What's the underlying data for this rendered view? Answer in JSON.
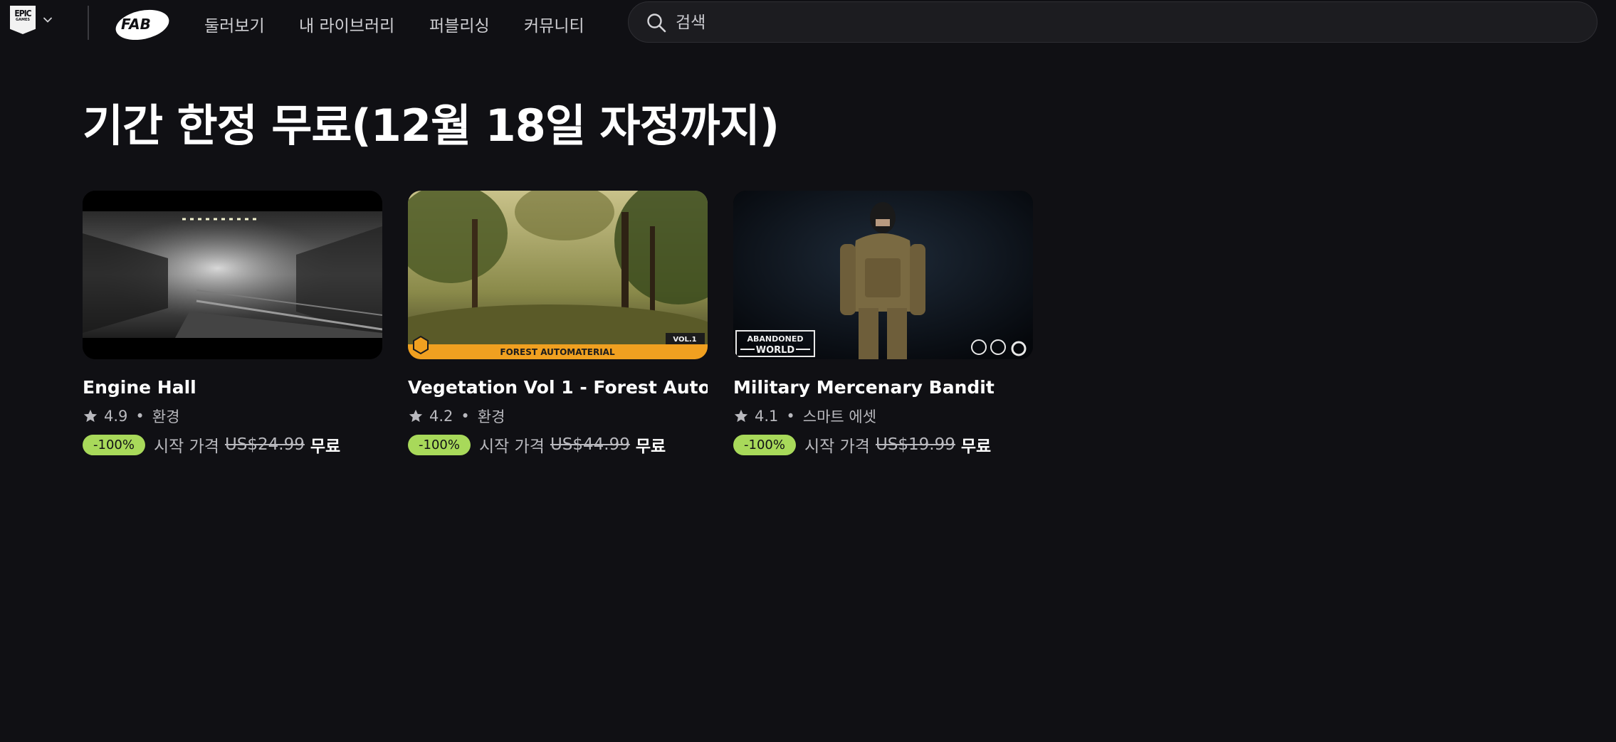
{
  "header": {
    "epic_logo_text": "EPIC",
    "epic_logo_subtext": "GAMES",
    "fab_logo_text": "FAB",
    "nav": [
      {
        "label": "둘러보기"
      },
      {
        "label": "내 라이브러리"
      },
      {
        "label": "퍼블리싱"
      },
      {
        "label": "커뮤니티"
      }
    ],
    "search_placeholder": "검색"
  },
  "main": {
    "title": "기간 한정 무료(12월 18일 자정까지)",
    "cards": [
      {
        "title": "Engine Hall",
        "rating": "4.9",
        "category": "환경",
        "discount": "-100%",
        "price_prefix": "시작 가격",
        "original_price": "US$24.99",
        "final_price": "무료"
      },
      {
        "title": "Vegetation Vol 1 - Forest Auto…",
        "rating": "4.2",
        "category": "환경",
        "discount": "-100%",
        "price_prefix": "시작 가격",
        "original_price": "US$44.99",
        "final_price": "무료",
        "thumb_banner": "FOREST AUTOMATERIAL",
        "thumb_tag": "VOL.1"
      },
      {
        "title": "Military Mercenary Bandit",
        "rating": "4.1",
        "category": "스마트 에셋",
        "discount": "-100%",
        "price_prefix": "시작 가격",
        "original_price": "US$19.99",
        "final_price": "무료",
        "thumb_logo_line1": "ABANDONED",
        "thumb_logo_line2": "WORLD"
      }
    ]
  },
  "colors": {
    "background": "#101014",
    "discount_badge": "#a8d95a",
    "banner_orange": "#f0a020"
  }
}
